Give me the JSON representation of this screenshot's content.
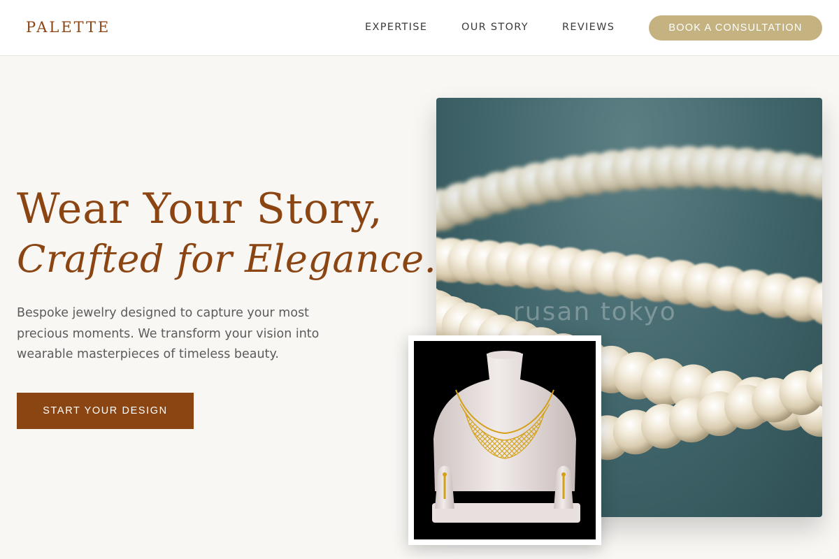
{
  "header": {
    "logo": "PALETTE",
    "nav": [
      {
        "label": "EXPERTISE"
      },
      {
        "label": "OUR STORY"
      },
      {
        "label": "REVIEWS"
      }
    ],
    "cta_label": "BOOK A CONSULTATION"
  },
  "hero": {
    "title_line1": "Wear Your Story,",
    "title_line2": "Crafted for Elegance.",
    "description": "Bespoke jewelry designed to capture your most precious moments. We transform your vision into wearable masterpieces of timeless beauty.",
    "cta_label": "START YOUR DESIGN"
  },
  "images": {
    "main": {
      "subject": "pearl necklace strands on teal fabric",
      "watermark": "rusan tokyo"
    },
    "inset": {
      "subject": "gold necklace and earrings on white display bust"
    }
  },
  "colors": {
    "brand_brown": "#8b4513",
    "gold_button": "#c4b280",
    "background": "#f9f7f4",
    "body_text": "#5b5b5b"
  }
}
